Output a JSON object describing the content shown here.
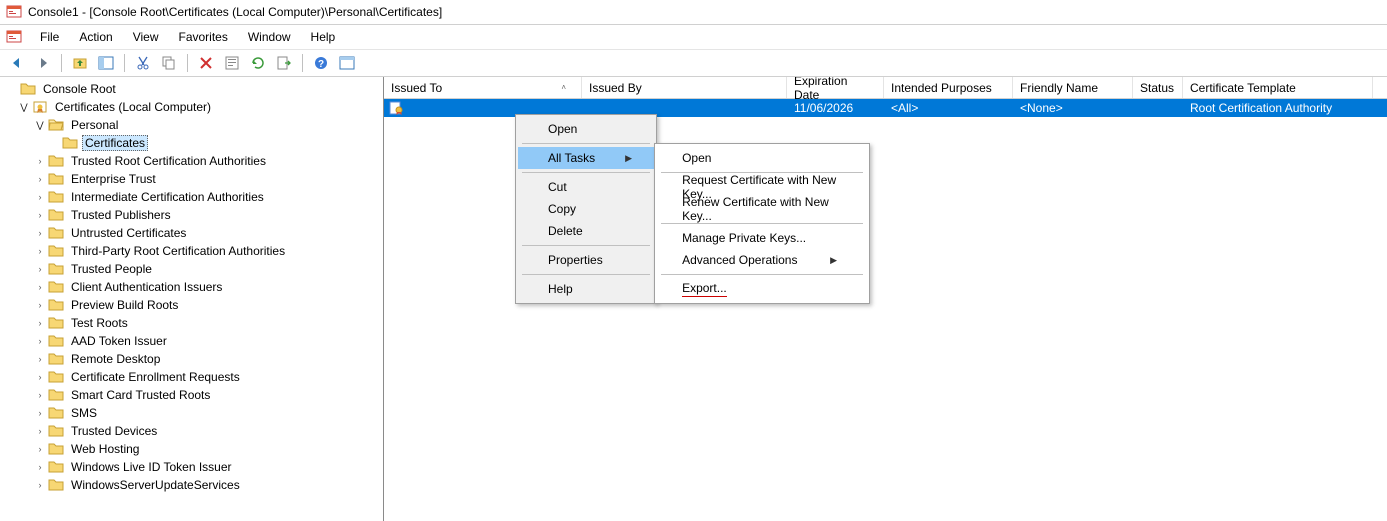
{
  "title": "Console1 - [Console Root\\Certificates (Local Computer)\\Personal\\Certificates]",
  "menu": {
    "file": "File",
    "action": "Action",
    "view": "View",
    "favorites": "Favorites",
    "window": "Window",
    "help": "Help"
  },
  "tree": {
    "root": "Console Root",
    "certs": "Certificates (Local Computer)",
    "personal": "Personal",
    "certificates": "Certificates",
    "nodes": [
      "Trusted Root Certification Authorities",
      "Enterprise Trust",
      "Intermediate Certification Authorities",
      "Trusted Publishers",
      "Untrusted Certificates",
      "Third-Party Root Certification Authorities",
      "Trusted People",
      "Client Authentication Issuers",
      "Preview Build Roots",
      "Test Roots",
      "AAD Token Issuer",
      "Remote Desktop",
      "Certificate Enrollment Requests",
      "Smart Card Trusted Roots",
      "SMS",
      "Trusted Devices",
      "Web Hosting",
      "Windows Live ID Token Issuer",
      "WindowsServerUpdateServices"
    ]
  },
  "cols": {
    "issued_to": "Issued To",
    "issued_by": "Issued By",
    "expiration": "Expiration Date",
    "purposes": "Intended Purposes",
    "friendly": "Friendly Name",
    "status": "Status",
    "template": "Certificate Template"
  },
  "row": {
    "issued_to": "",
    "issued_by": "",
    "expiration": "11/06/2026",
    "purposes": "<All>",
    "friendly": "<None>",
    "status": "",
    "template": "Root Certification Authority"
  },
  "ctx": {
    "open": "Open",
    "alltasks": "All Tasks",
    "cut": "Cut",
    "copy": "Copy",
    "delete": "Delete",
    "properties": "Properties",
    "help": "Help"
  },
  "sub": {
    "open": "Open",
    "request": "Request Certificate with New Key...",
    "renew": "Renew Certificate with New Key...",
    "manage": "Manage Private Keys...",
    "advanced": "Advanced Operations",
    "export": "Export..."
  }
}
